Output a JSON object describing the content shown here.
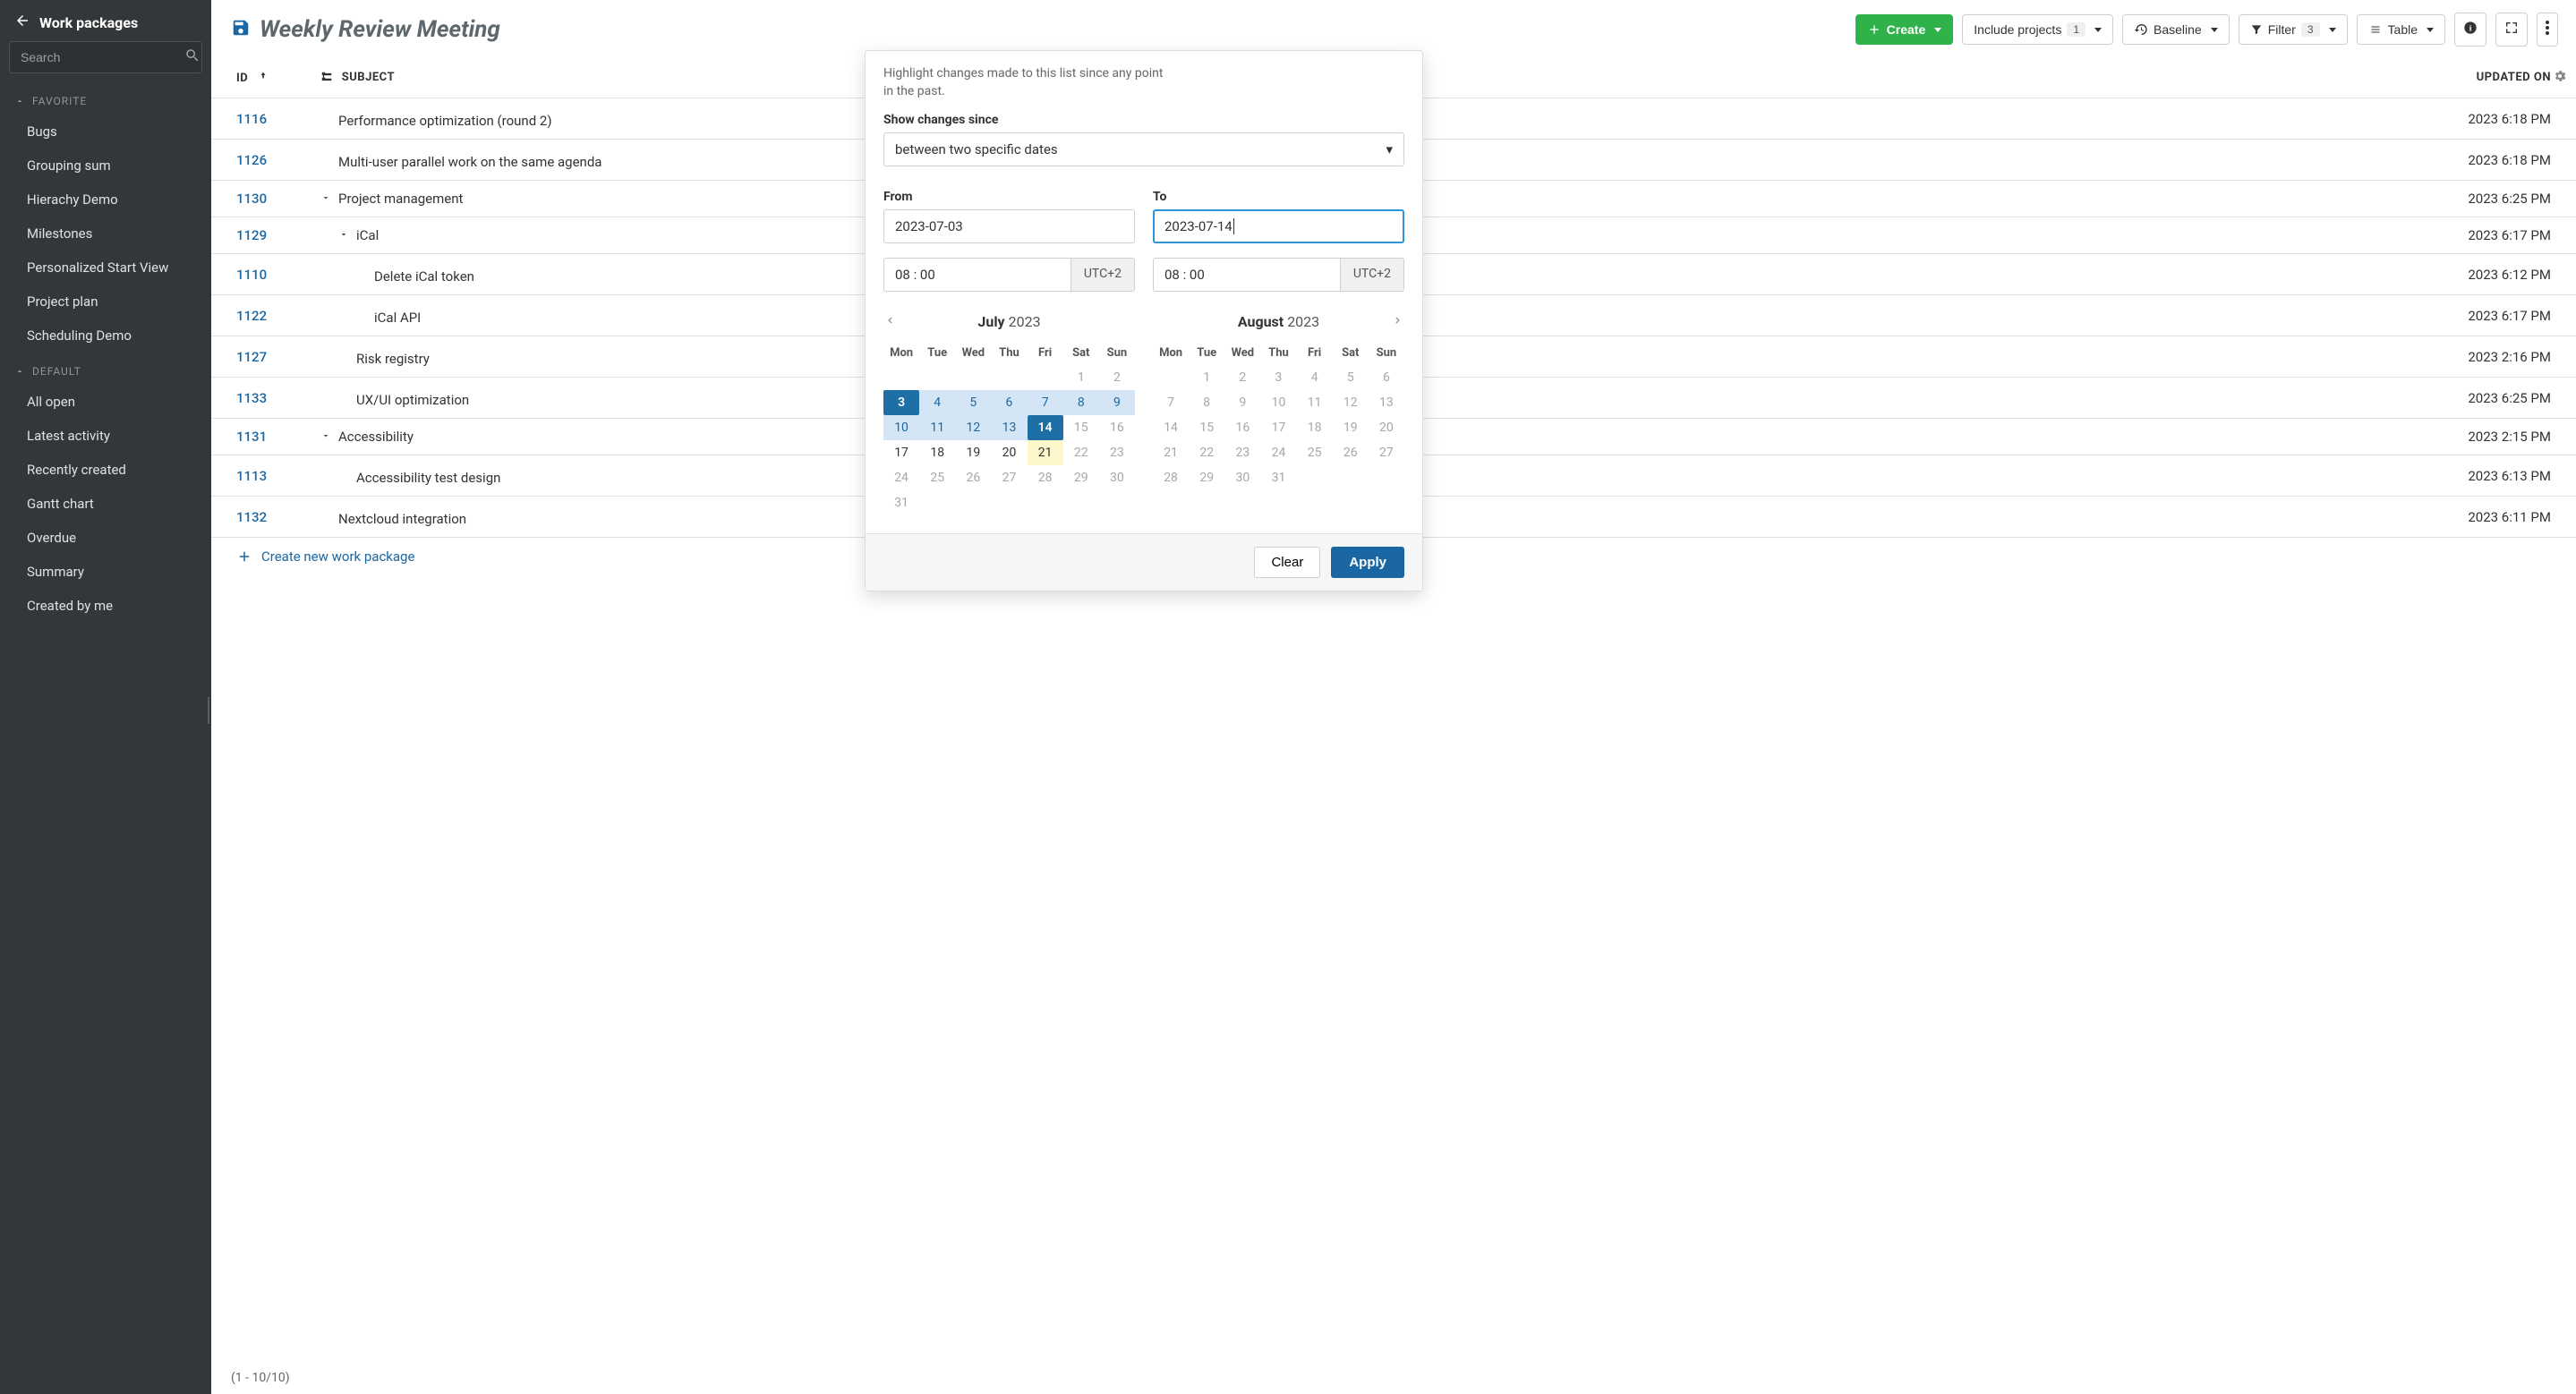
{
  "sidebar": {
    "title": "Work packages",
    "search_placeholder": "Search",
    "groups": [
      {
        "label": "FAVORITE",
        "items": [
          "Bugs",
          "Grouping sum",
          "Hierachy Demo",
          "Milestones",
          "Personalized Start View",
          "Project plan",
          "Scheduling Demo"
        ]
      },
      {
        "label": "DEFAULT",
        "items": [
          "All open",
          "Latest activity",
          "Recently created",
          "Gantt chart",
          "Overdue",
          "Summary",
          "Created by me"
        ]
      }
    ]
  },
  "header": {
    "title": "Weekly Review Meeting",
    "create": "Create",
    "include_projects": {
      "label": "Include projects",
      "count": "1"
    },
    "baseline": "Baseline",
    "filter": {
      "label": "Filter",
      "count": "3"
    },
    "table": "Table"
  },
  "table": {
    "columns": {
      "id": "ID",
      "subject": "SUBJECT",
      "updated": "UPDATED ON"
    },
    "rows": [
      {
        "id": "1116",
        "indent": 0,
        "chevron": "",
        "subject": "Performance optimization (round 2)",
        "updated": "2023 6:18 PM"
      },
      {
        "id": "1126",
        "indent": 0,
        "chevron": "",
        "subject": "Multi-user parallel work on the same agenda",
        "updated": "2023 6:18 PM"
      },
      {
        "id": "1130",
        "indent": 0,
        "chevron": "down",
        "subject": "Project management",
        "updated": "2023 6:25 PM"
      },
      {
        "id": "1129",
        "indent": 1,
        "chevron": "down",
        "subject": "iCal",
        "updated": "2023 6:17 PM"
      },
      {
        "id": "1110",
        "indent": 2,
        "chevron": "",
        "subject": "Delete iCal token",
        "updated": "2023 6:12 PM"
      },
      {
        "id": "1122",
        "indent": 2,
        "chevron": "",
        "subject": "iCal API",
        "updated": "2023 6:17 PM"
      },
      {
        "id": "1127",
        "indent": 1,
        "chevron": "",
        "subject": "Risk registry",
        "updated": "2023 2:16 PM"
      },
      {
        "id": "1133",
        "indent": 1,
        "chevron": "",
        "subject": "UX/UI optimization",
        "updated": "2023 6:25 PM"
      },
      {
        "id": "1131",
        "indent": 0,
        "chevron": "down",
        "subject": "Accessibility",
        "updated": "2023 2:15 PM"
      },
      {
        "id": "1113",
        "indent": 1,
        "chevron": "",
        "subject": "Accessibility test design",
        "updated": "2023 6:13 PM"
      },
      {
        "id": "1132",
        "indent": 0,
        "chevron": "",
        "subject": "Nextcloud integration",
        "updated": "2023 6:11 PM"
      }
    ],
    "create_label": "Create new work package",
    "footer": "(1 - 10/10)"
  },
  "baseline_panel": {
    "description": "Highlight changes made to this list since any point in the past.",
    "show_label": "Show changes since",
    "mode": "between two specific dates",
    "from_label": "From",
    "from_value": "2023-07-03",
    "from_time": "08 : 00",
    "to_label": "To",
    "to_value": "2023-07-14",
    "to_time": "08 : 00",
    "tz": "UTC+2",
    "clear": "Clear",
    "apply": "Apply",
    "dow": [
      "Mon",
      "Tue",
      "Wed",
      "Thu",
      "Fri",
      "Sat",
      "Sun"
    ],
    "cal1": {
      "month": "July",
      "year": "2023",
      "days": [
        {
          "n": "",
          "s": ""
        },
        {
          "n": "",
          "s": ""
        },
        {
          "n": "",
          "s": ""
        },
        {
          "n": "",
          "s": ""
        },
        {
          "n": "",
          "s": ""
        },
        {
          "n": "1",
          "s": "off"
        },
        {
          "n": "2",
          "s": "off"
        },
        {
          "n": "3",
          "s": "selected"
        },
        {
          "n": "4",
          "s": "in-range"
        },
        {
          "n": "5",
          "s": "in-range"
        },
        {
          "n": "6",
          "s": "in-range"
        },
        {
          "n": "7",
          "s": "in-range"
        },
        {
          "n": "8",
          "s": "in-range"
        },
        {
          "n": "9",
          "s": "in-range"
        },
        {
          "n": "10",
          "s": "in-range"
        },
        {
          "n": "11",
          "s": "in-range"
        },
        {
          "n": "12",
          "s": "in-range"
        },
        {
          "n": "13",
          "s": "in-range"
        },
        {
          "n": "14",
          "s": "selected"
        },
        {
          "n": "15",
          "s": "off"
        },
        {
          "n": "16",
          "s": "off"
        },
        {
          "n": "17",
          "s": ""
        },
        {
          "n": "18",
          "s": ""
        },
        {
          "n": "19",
          "s": ""
        },
        {
          "n": "20",
          "s": ""
        },
        {
          "n": "21",
          "s": "today"
        },
        {
          "n": "22",
          "s": "off"
        },
        {
          "n": "23",
          "s": "off"
        },
        {
          "n": "24",
          "s": "off"
        },
        {
          "n": "25",
          "s": "off"
        },
        {
          "n": "26",
          "s": "off"
        },
        {
          "n": "27",
          "s": "off"
        },
        {
          "n": "28",
          "s": "off"
        },
        {
          "n": "29",
          "s": "off"
        },
        {
          "n": "30",
          "s": "off"
        },
        {
          "n": "31",
          "s": "off"
        }
      ]
    },
    "cal2": {
      "month": "August",
      "year": "2023",
      "days": [
        {
          "n": "",
          "s": ""
        },
        {
          "n": "1",
          "s": "off"
        },
        {
          "n": "2",
          "s": "off"
        },
        {
          "n": "3",
          "s": "off"
        },
        {
          "n": "4",
          "s": "off"
        },
        {
          "n": "5",
          "s": "off"
        },
        {
          "n": "6",
          "s": "off"
        },
        {
          "n": "7",
          "s": "off"
        },
        {
          "n": "8",
          "s": "off"
        },
        {
          "n": "9",
          "s": "off"
        },
        {
          "n": "10",
          "s": "off"
        },
        {
          "n": "11",
          "s": "off"
        },
        {
          "n": "12",
          "s": "off"
        },
        {
          "n": "13",
          "s": "off"
        },
        {
          "n": "14",
          "s": "off"
        },
        {
          "n": "15",
          "s": "off"
        },
        {
          "n": "16",
          "s": "off"
        },
        {
          "n": "17",
          "s": "off"
        },
        {
          "n": "18",
          "s": "off"
        },
        {
          "n": "19",
          "s": "off"
        },
        {
          "n": "20",
          "s": "off"
        },
        {
          "n": "21",
          "s": "off"
        },
        {
          "n": "22",
          "s": "off"
        },
        {
          "n": "23",
          "s": "off"
        },
        {
          "n": "24",
          "s": "off"
        },
        {
          "n": "25",
          "s": "off"
        },
        {
          "n": "26",
          "s": "off"
        },
        {
          "n": "27",
          "s": "off"
        },
        {
          "n": "28",
          "s": "off"
        },
        {
          "n": "29",
          "s": "off"
        },
        {
          "n": "30",
          "s": "off"
        },
        {
          "n": "31",
          "s": "off"
        }
      ]
    }
  }
}
